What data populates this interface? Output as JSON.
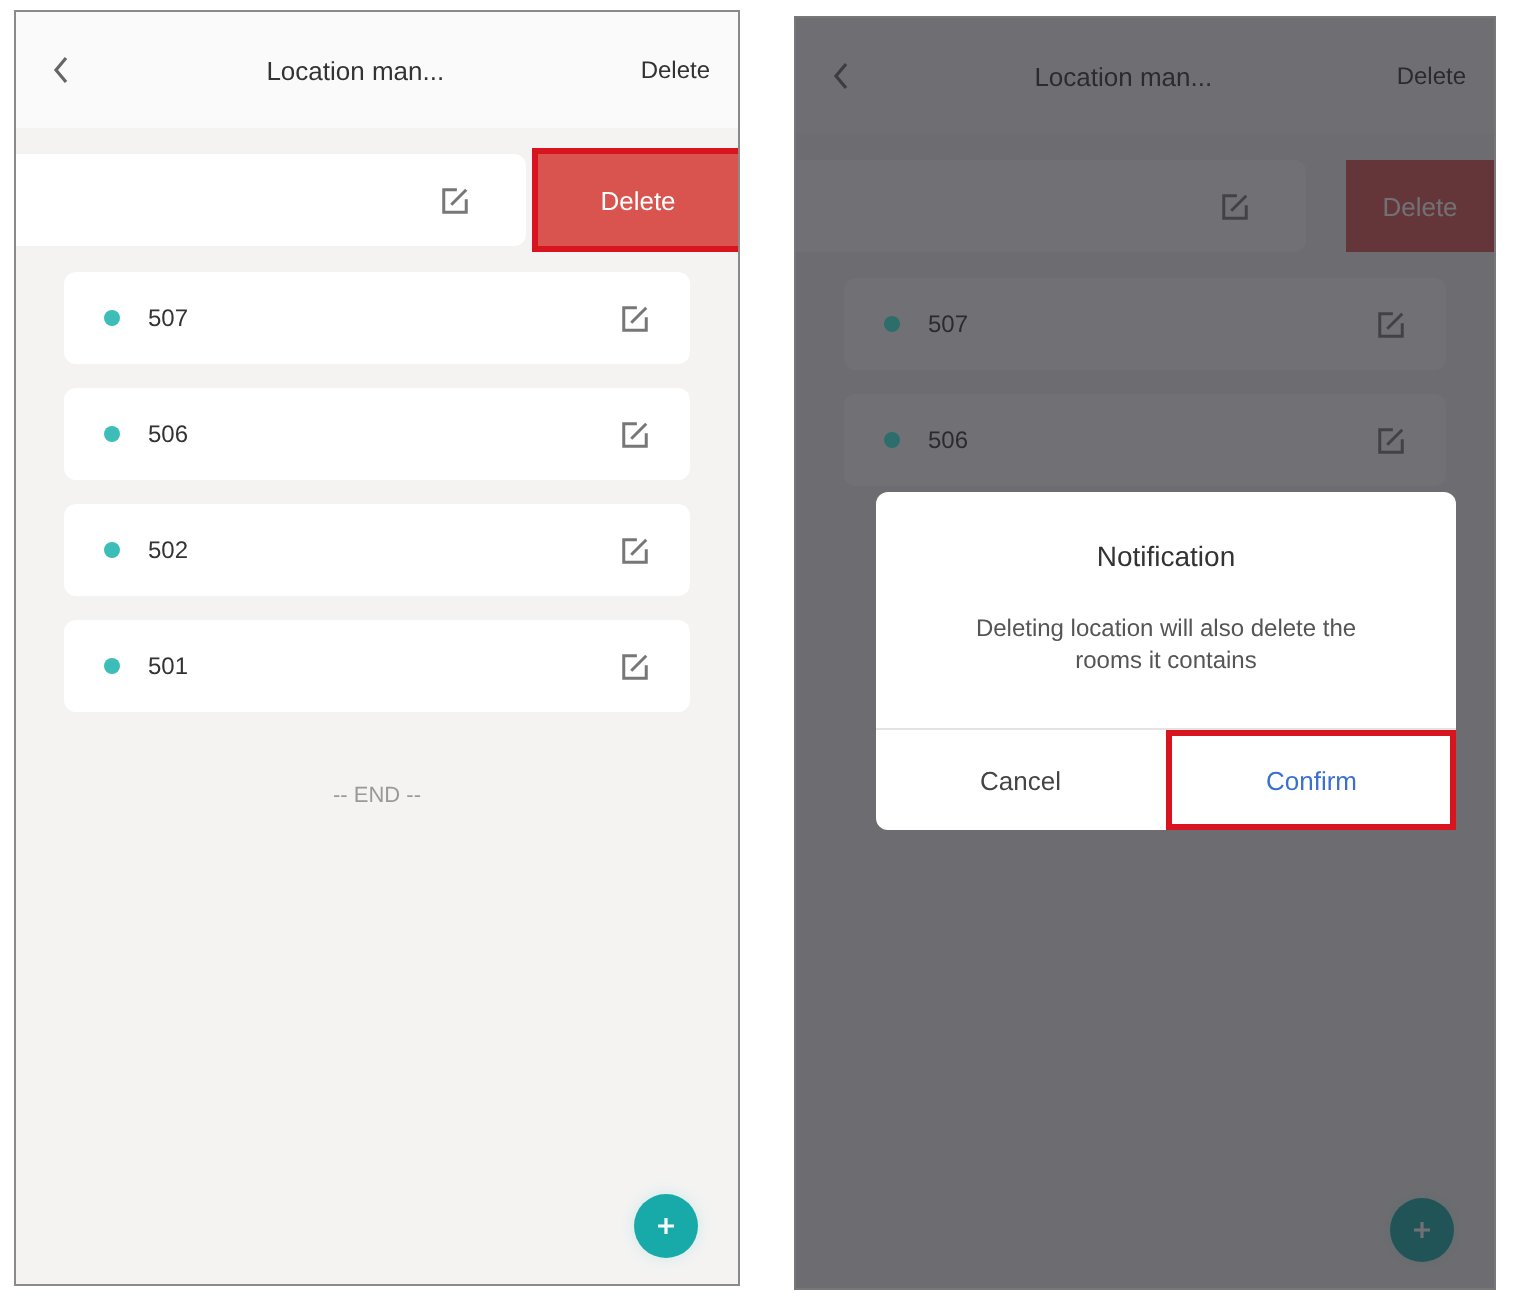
{
  "screens": [
    {
      "header": {
        "title": "Location man...",
        "action": "Delete"
      },
      "swiped_row": {
        "action": "Delete",
        "highlighted": true
      },
      "rows": [
        {
          "name": "507",
          "color": "#3dbdb8"
        },
        {
          "name": "506",
          "color": "#3dbdb8"
        },
        {
          "name": "502",
          "color": "#3dbdb8"
        },
        {
          "name": "501",
          "color": "#3dbdb8"
        }
      ],
      "end_text": "-- END --",
      "dimmed": false
    },
    {
      "header": {
        "title": "Location man...",
        "action": "Delete"
      },
      "swiped_row": {
        "action": "Delete",
        "highlighted": false
      },
      "rows": [
        {
          "name": "507",
          "color": "#2c6e6c"
        },
        {
          "name": "506",
          "color": "#2c6e6c"
        }
      ],
      "dimmed": true,
      "dialog": {
        "title": "Notification",
        "message": "Deleting location will also delete the rooms it contains",
        "buttons": [
          {
            "label": "Cancel",
            "kind": "secondary",
            "highlighted": false
          },
          {
            "label": "Confirm",
            "kind": "primary",
            "highlighted": true
          }
        ]
      }
    }
  ]
}
